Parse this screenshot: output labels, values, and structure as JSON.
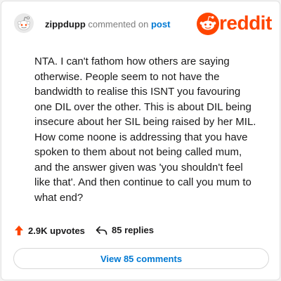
{
  "comment": {
    "username": "zippdupp",
    "action_text": " commented on ",
    "post_link": "post",
    "body": "NTA. I can't fathom how others are saying otherwise. People seem to not have the bandwidth to realise this ISNT you favouring one DIL over the other. This is about DIL being insecure about her SIL being raised by her MIL. How come noone is addressing that you have spoken to them about not being called mum, and the answer given was 'you shouldn't feel like that'. And then continue to call you mum to what end?"
  },
  "logo": {
    "text": "reddit",
    "icon": "reddit-snoo-icon",
    "color": "#ff4500"
  },
  "actions": {
    "upvotes": "2.9K upvotes",
    "replies": "85 replies",
    "upvote_icon": "upvote-arrow-icon",
    "reply_icon": "reply-arrow-icon",
    "upvote_color": "#ff4500"
  },
  "view_button": {
    "label": "View 85 comments"
  },
  "colors": {
    "link": "#0079d3",
    "text": "#1a1a1b",
    "muted": "#7c7c7c"
  }
}
